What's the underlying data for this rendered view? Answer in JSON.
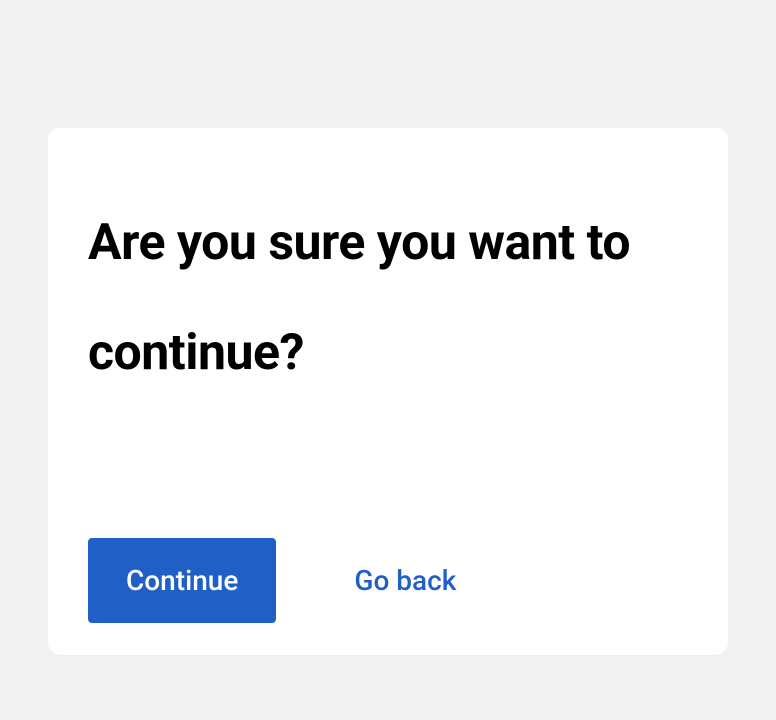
{
  "dialog": {
    "title": "Are you sure you want to continue?",
    "actions": {
      "primary": "Continue",
      "secondary": "Go back"
    }
  }
}
